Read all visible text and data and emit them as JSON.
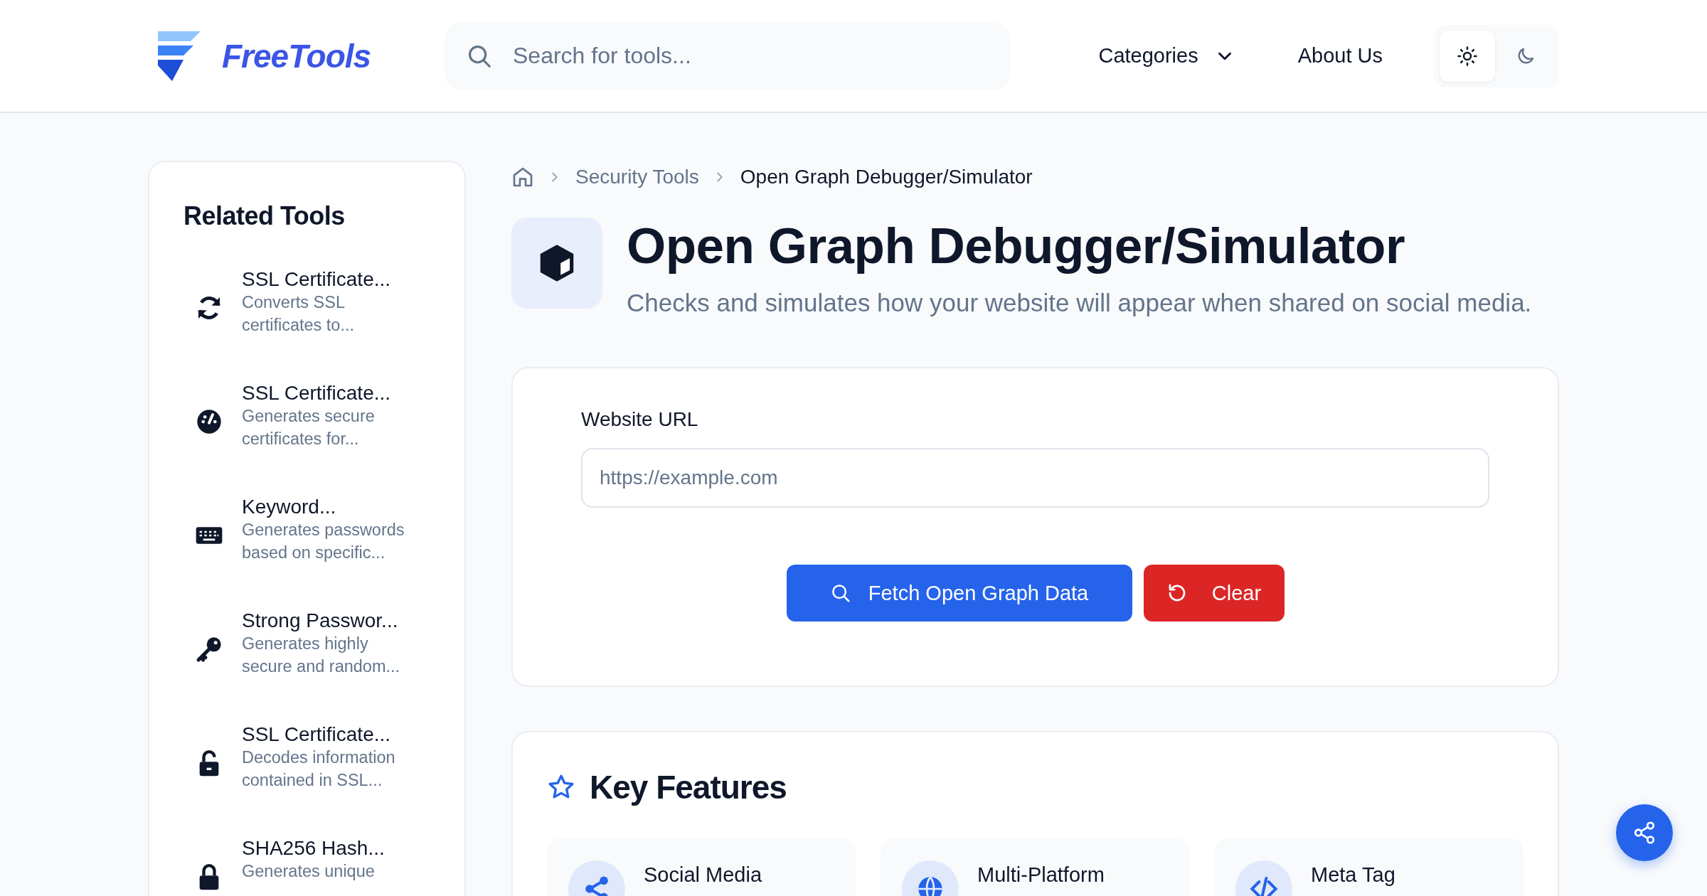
{
  "header": {
    "logo": "FreeTools",
    "search": {
      "placeholder": "Search for tools..."
    },
    "nav": [
      {
        "label": "Categories",
        "kind": "dropdown"
      },
      {
        "label": "About Us",
        "kind": "link"
      }
    ],
    "theme": [
      {
        "kind": "light",
        "selected": true
      },
      {
        "kind": "dark",
        "selected": false
      }
    ]
  },
  "sidebar": {
    "title": "Related Tools",
    "items": [
      {
        "title": "SSL Certificate...",
        "description": "Converts SSL certificates to..."
      },
      {
        "title": "SSL Certificate...",
        "description": "Generates secure certificates for..."
      },
      {
        "title": "Keyword...",
        "description": "Generates passwords based on specific..."
      },
      {
        "title": "Strong Passwor...",
        "description": "Generates highly secure and random..."
      },
      {
        "title": "SSL Certificate...",
        "description": "Decodes information contained in SSL..."
      },
      {
        "title": "SHA256 Hash...",
        "description": "Generates unique"
      }
    ]
  },
  "breadcrumb": [
    "Security Tools",
    "Open Graph Debugger/Simulator"
  ],
  "tool": {
    "title": "Open Graph Debugger/Simulator",
    "subtitle": "Checks and simulates how your website will appear when shared on social media.",
    "form": {
      "label": "Website URL",
      "placeholder": "https://example.com",
      "buttons": [
        {
          "label": "Fetch Open Graph Data",
          "kind": "primary"
        },
        {
          "label": "Clear",
          "kind": "danger"
        }
      ]
    }
  },
  "features": {
    "title": "Key Features",
    "items": [
      {
        "title": "Social Media"
      },
      {
        "title": "Multi-Platform"
      },
      {
        "title": "Meta Tag"
      }
    ]
  }
}
